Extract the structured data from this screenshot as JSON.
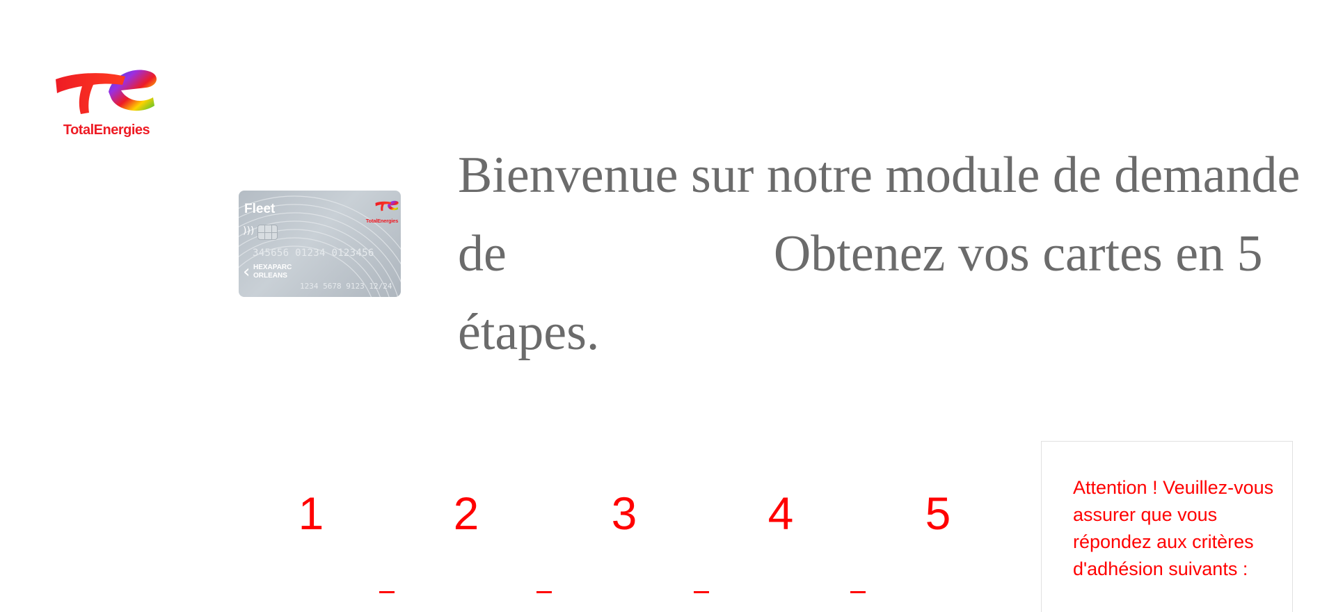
{
  "brand": {
    "name": "TotalEnergies",
    "color_primary": "#ee1c25"
  },
  "card": {
    "label": "Fleet",
    "number": "345656 01234 0123456",
    "holder": "HEXAPARC\nORLEANS",
    "expiry": "1234 5678 9123  12/24",
    "logo_text": "TotalEnergies"
  },
  "headline": {
    "line1": "Bienvenue sur notre module de demande",
    "line2_start": "de",
    "line2_end": "Obtenez vos cartes en 5",
    "line3": "étapes."
  },
  "steps": {
    "numbers": [
      "1",
      "2",
      "3",
      "4",
      "5"
    ],
    "accent_color": "#ff0000"
  },
  "notice": {
    "text": "Attention ! Veuillez-vous assurer que vous répondez aux critères d'adhésion suivants :"
  }
}
